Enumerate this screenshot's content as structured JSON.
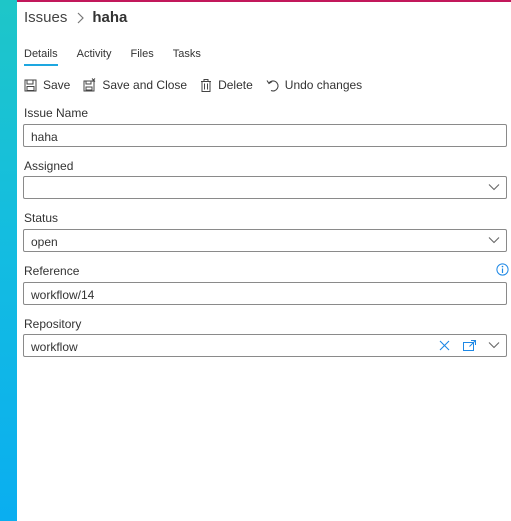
{
  "colors": {
    "accent": "#1ea7e0",
    "sidebar_top": "#1ec6c8",
    "sidebar_bottom": "#0aaef0",
    "top_strip": "#c2185b"
  },
  "breadcrumb": {
    "parent": "Issues",
    "current": "haha"
  },
  "tabs": [
    {
      "label": "Details",
      "active": true
    },
    {
      "label": "Activity",
      "active": false
    },
    {
      "label": "Files",
      "active": false
    },
    {
      "label": "Tasks",
      "active": false
    }
  ],
  "toolbar": {
    "save": {
      "label": "Save",
      "icon": "floppy-disk-icon"
    },
    "save_close": {
      "label": "Save and Close",
      "icon": "save-close-icon"
    },
    "delete": {
      "label": "Delete",
      "icon": "trash-icon"
    },
    "undo": {
      "label": "Undo changes",
      "icon": "undo-icon"
    }
  },
  "form": {
    "issue_name": {
      "label": "Issue Name",
      "value": "haha"
    },
    "assigned": {
      "label": "Assigned",
      "value": ""
    },
    "status": {
      "label": "Status",
      "value": "open"
    },
    "reference": {
      "label": "Reference",
      "value": "workflow/14"
    },
    "repository": {
      "label": "Repository",
      "value": "workflow"
    }
  }
}
